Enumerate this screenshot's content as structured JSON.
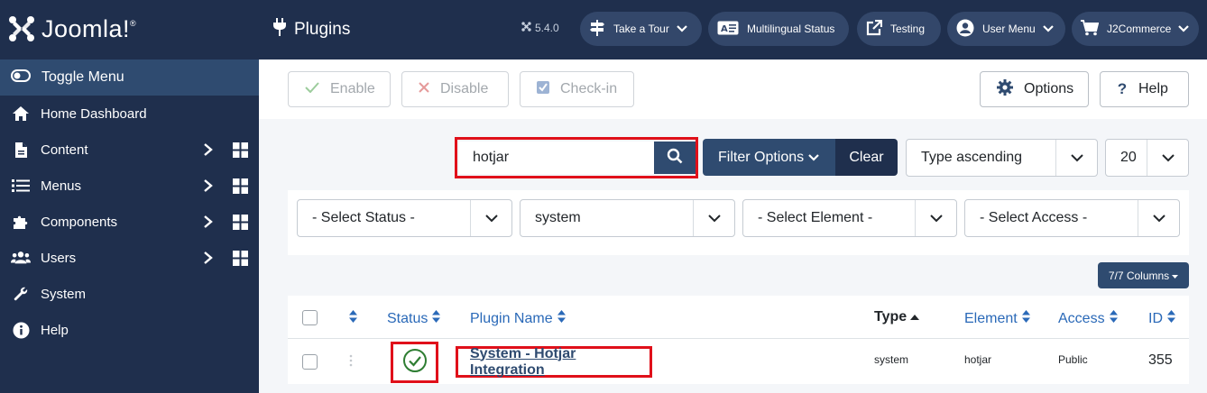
{
  "sidebar": {
    "logo_text": "Joomla!",
    "logo_mark": "®",
    "toggle_label": "Toggle Menu",
    "items": [
      {
        "label": "Home Dashboard",
        "icon": "home-icon"
      },
      {
        "label": "Content",
        "icon": "file-icon"
      },
      {
        "label": "Menus",
        "icon": "list-icon"
      },
      {
        "label": "Components",
        "icon": "puzzle-icon"
      },
      {
        "label": "Users",
        "icon": "users-icon"
      },
      {
        "label": "System",
        "icon": "wrench-icon"
      },
      {
        "label": "Help",
        "icon": "info-icon"
      }
    ]
  },
  "header": {
    "title": "Plugins",
    "version": "5.4.0",
    "buttons": [
      {
        "label": "Take a Tour",
        "icon": "signpost-icon"
      },
      {
        "label": "Multilingual Status",
        "icon": "language-icon"
      },
      {
        "label": "Testing",
        "icon": "external-link-icon"
      },
      {
        "label": "User Menu",
        "icon": "user-icon"
      },
      {
        "label": "J2Commerce",
        "icon": "cart-icon"
      }
    ]
  },
  "toolbar": {
    "enable": "Enable",
    "disable": "Disable",
    "checkin": "Check-in",
    "options": "Options",
    "help": "Help"
  },
  "search": {
    "value": "hotjar",
    "filter_options": "Filter Options",
    "clear": "Clear",
    "ordering": "Type ascending",
    "limit": "20"
  },
  "filters": {
    "status": "- Select Status -",
    "folder": "system",
    "element": "- Select Element -",
    "access": "- Select Access -"
  },
  "columns_button": "7/7 Columns",
  "table": {
    "headers": {
      "status": "Status",
      "name": "Plugin Name",
      "type": "Type",
      "element": "Element",
      "access": "Access",
      "id": "ID"
    },
    "rows": [
      {
        "name": "System - Hotjar Integration",
        "type": "system",
        "element": "hotjar",
        "access": "Public",
        "id": "355",
        "enabled": true
      }
    ]
  },
  "colors": {
    "sidebar_bg": "#1f2f4d",
    "accent": "#2f4b70",
    "highlight": "#e0101a",
    "link": "#2a69b8",
    "success": "#2e7d32"
  }
}
